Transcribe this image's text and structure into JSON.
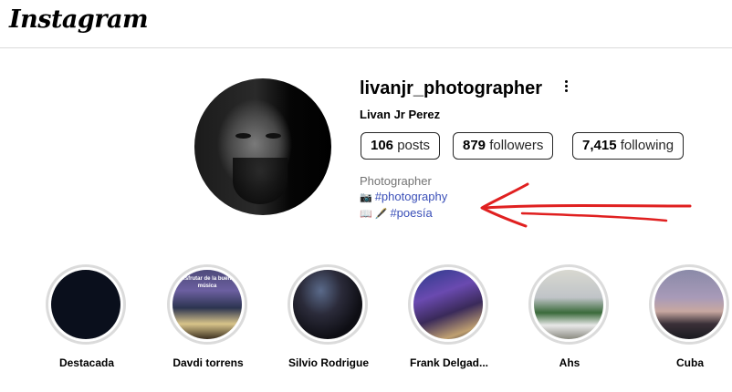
{
  "app": {
    "logo": "Instagram"
  },
  "profile": {
    "username": "livanjr_photographer",
    "full_name": "Livan Jr Perez",
    "stats": {
      "posts_count": "106",
      "posts_label": "posts",
      "followers_count": "879",
      "followers_label": "followers",
      "following_count": "7,415",
      "following_label": "following"
    },
    "bio": {
      "title": "Photographer",
      "line1_emoji": "📷",
      "line1_tag": "#photography",
      "line2_emoji": "📖 🖋️",
      "line2_tag": "#poesía"
    }
  },
  "highlights": [
    {
      "label": "Destacada",
      "caption": ""
    },
    {
      "label": "Davdi torrens",
      "caption": "disfrutar de la buena música"
    },
    {
      "label": "Silvio Rodrigue",
      "caption": ""
    },
    {
      "label": "Frank Delgad...",
      "caption": ""
    },
    {
      "label": "Ahs",
      "caption": ""
    },
    {
      "label": "Cuba",
      "caption": ""
    }
  ],
  "colors": {
    "accent": "#3a4fb8",
    "annotation_arrow": "#e02020",
    "border": "#dbdbdb"
  }
}
